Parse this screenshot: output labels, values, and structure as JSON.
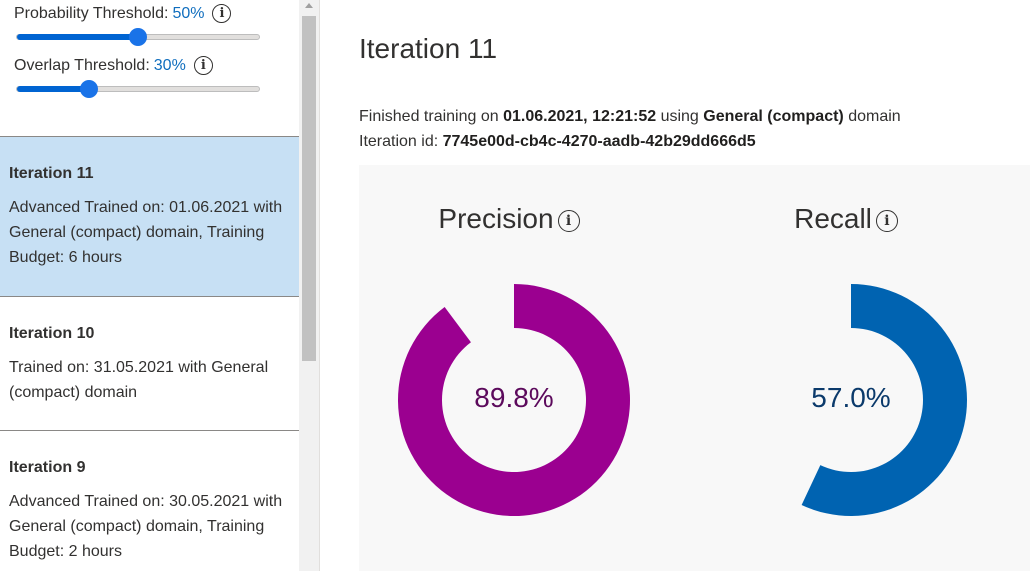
{
  "sliders": {
    "probability": {
      "label": "Probability Threshold:",
      "value": "50%",
      "fraction": 0.5
    },
    "overlap": {
      "label": "Overlap Threshold:",
      "value": "30%",
      "fraction": 0.3
    }
  },
  "iterations": [
    {
      "name": "Iteration 11",
      "desc": "Advanced Trained on: 01.06.2021 with General (compact) domain, Training Budget: 6 hours",
      "selected": true
    },
    {
      "name": "Iteration 10",
      "desc": "Trained on: 31.05.2021 with General (compact) domain",
      "selected": false
    },
    {
      "name": "Iteration 9",
      "desc": "Advanced Trained on: 30.05.2021 with General (compact) domain, Training Budget: 2 hours",
      "selected": false
    }
  ],
  "main": {
    "title": "Iteration 11",
    "finished_prefix": "Finished training on",
    "finished_date": "01.06.2021, 12:21:52",
    "using_text": "using",
    "domain_name": "General (compact)",
    "domain_suffix": "domain",
    "iteration_id_label": "Iteration id:",
    "iteration_id": "7745e00d-cb4c-4270-aadb-42b29dd666d5"
  },
  "metrics": {
    "precision": {
      "title": "Precision",
      "value_text": "89.8%",
      "fraction": 0.898,
      "color": "#9b0090",
      "text_color": "#5c0a5c"
    },
    "recall": {
      "title": "Recall",
      "value_text": "57.0%",
      "fraction": 0.57,
      "color": "#0063b1",
      "text_color": "#0b3a6b"
    }
  },
  "icons": {
    "info": "i"
  }
}
